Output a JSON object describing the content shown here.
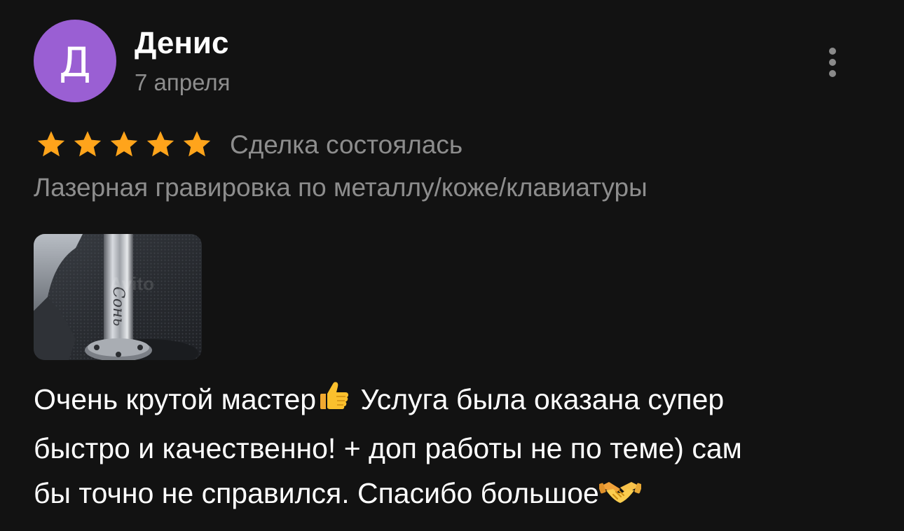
{
  "review": {
    "author": {
      "avatar_letter": "Д",
      "avatar_color": "#9a5fd3",
      "name": "Денис",
      "date": "7 апреля"
    },
    "menu_icon": "more-vertical-icon",
    "rating": {
      "stars": 5,
      "max_stars": 5,
      "star_color": "#ffa41b"
    },
    "deal_status": "Сделка состоялась",
    "service": "Лазерная гравировка по металлу/коже/клавиатуры",
    "photo": {
      "count": 1
    },
    "text": {
      "line1_start": "Очень крутой мастер",
      "emoji1": "thumbs-up-emoji",
      "line1_end": " Услуга была оказана супер",
      "line2": "быстро и качественно! + доп работы не по теме) сам",
      "line3": "бы точно не справился. Спасибо большое",
      "emoji2": "handshake-emoji"
    }
  }
}
